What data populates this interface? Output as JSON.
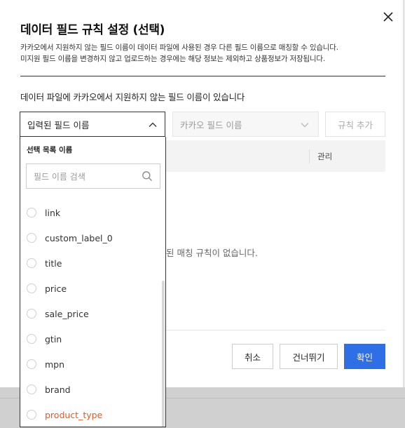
{
  "dialog": {
    "title": "데이터 필드 규칙 설정 (선택)",
    "desc_line1": "카카오에서 지원하지 않는 필드 이름이 데이터 파일에 사용된 경우 다른 필드 이름으로 매칭할 수 있습니다.",
    "desc_line2": "미지원 필드 이름을 변경하지 않고 업로드하는 경우에는 해당 정보는 제외하고 상품정보가 저장됩니다.",
    "section_label": "데이터 파일에 카카오에서 지원하지 않는 필드 이름이 있습니다"
  },
  "controls": {
    "input_field_dropdown": "입력된 필드 이름",
    "kakao_field_dropdown": "카카오 필드 이름",
    "add_rule_button": "규칙 추가"
  },
  "table": {
    "manage_header": "관리",
    "empty_message_visible": "된 매칭 규칙이 없습니다."
  },
  "dropdown_panel": {
    "list_title": "선택 목록 이름",
    "search_placeholder": "필드 이름 검색",
    "options": [
      {
        "label": "link"
      },
      {
        "label": "custom_label_0"
      },
      {
        "label": "title"
      },
      {
        "label": "price"
      },
      {
        "label": "sale_price"
      },
      {
        "label": "gtin"
      },
      {
        "label": "mpn"
      },
      {
        "label": "brand"
      },
      {
        "label": "product_type"
      }
    ]
  },
  "footer": {
    "cancel": "취소",
    "skip": "건너뛰기",
    "confirm": "확인"
  },
  "colors": {
    "primary": "#2f6fe5",
    "highlight_text": "#e05a2b"
  }
}
